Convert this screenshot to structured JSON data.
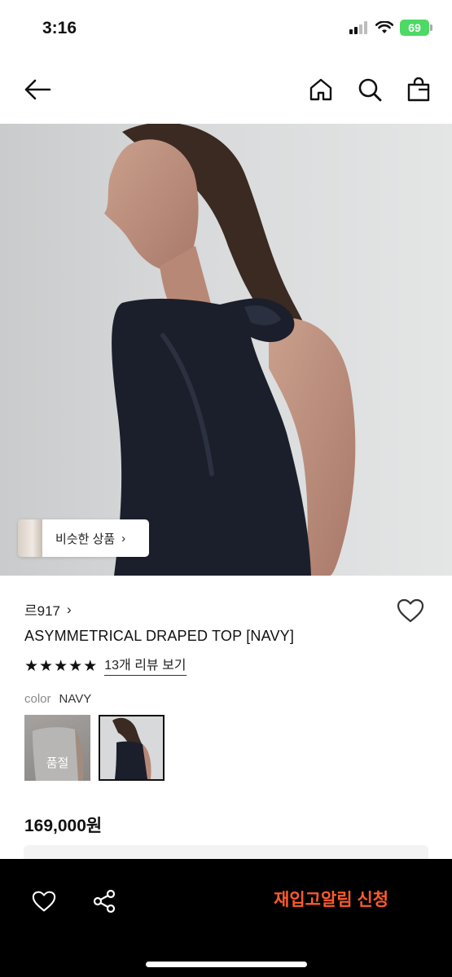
{
  "status_bar": {
    "time": "3:16",
    "battery": "69"
  },
  "nav": {
    "back_icon": "arrow-left-icon",
    "home_icon": "home-icon",
    "search_icon": "search-icon",
    "bag_icon": "shopping-bag-icon"
  },
  "hero": {
    "similar_label": "비슷한 상품",
    "similar_chevron": "›"
  },
  "product": {
    "brand": "르917",
    "brand_chevron": "›",
    "name": "ASYMMETRICAL DRAPED TOP [NAVY]",
    "rating": 5,
    "review_link": "13개 리뷰 보기",
    "color_key": "color",
    "color_value": "NAVY",
    "swatches": [
      {
        "label": "품절",
        "sold_out": true
      },
      {
        "label": "",
        "selected": true
      }
    ],
    "price": "169,000원"
  },
  "bottom_bar": {
    "restock_button": "재입고알림 신청",
    "accent_color": "#ff5a2d"
  }
}
